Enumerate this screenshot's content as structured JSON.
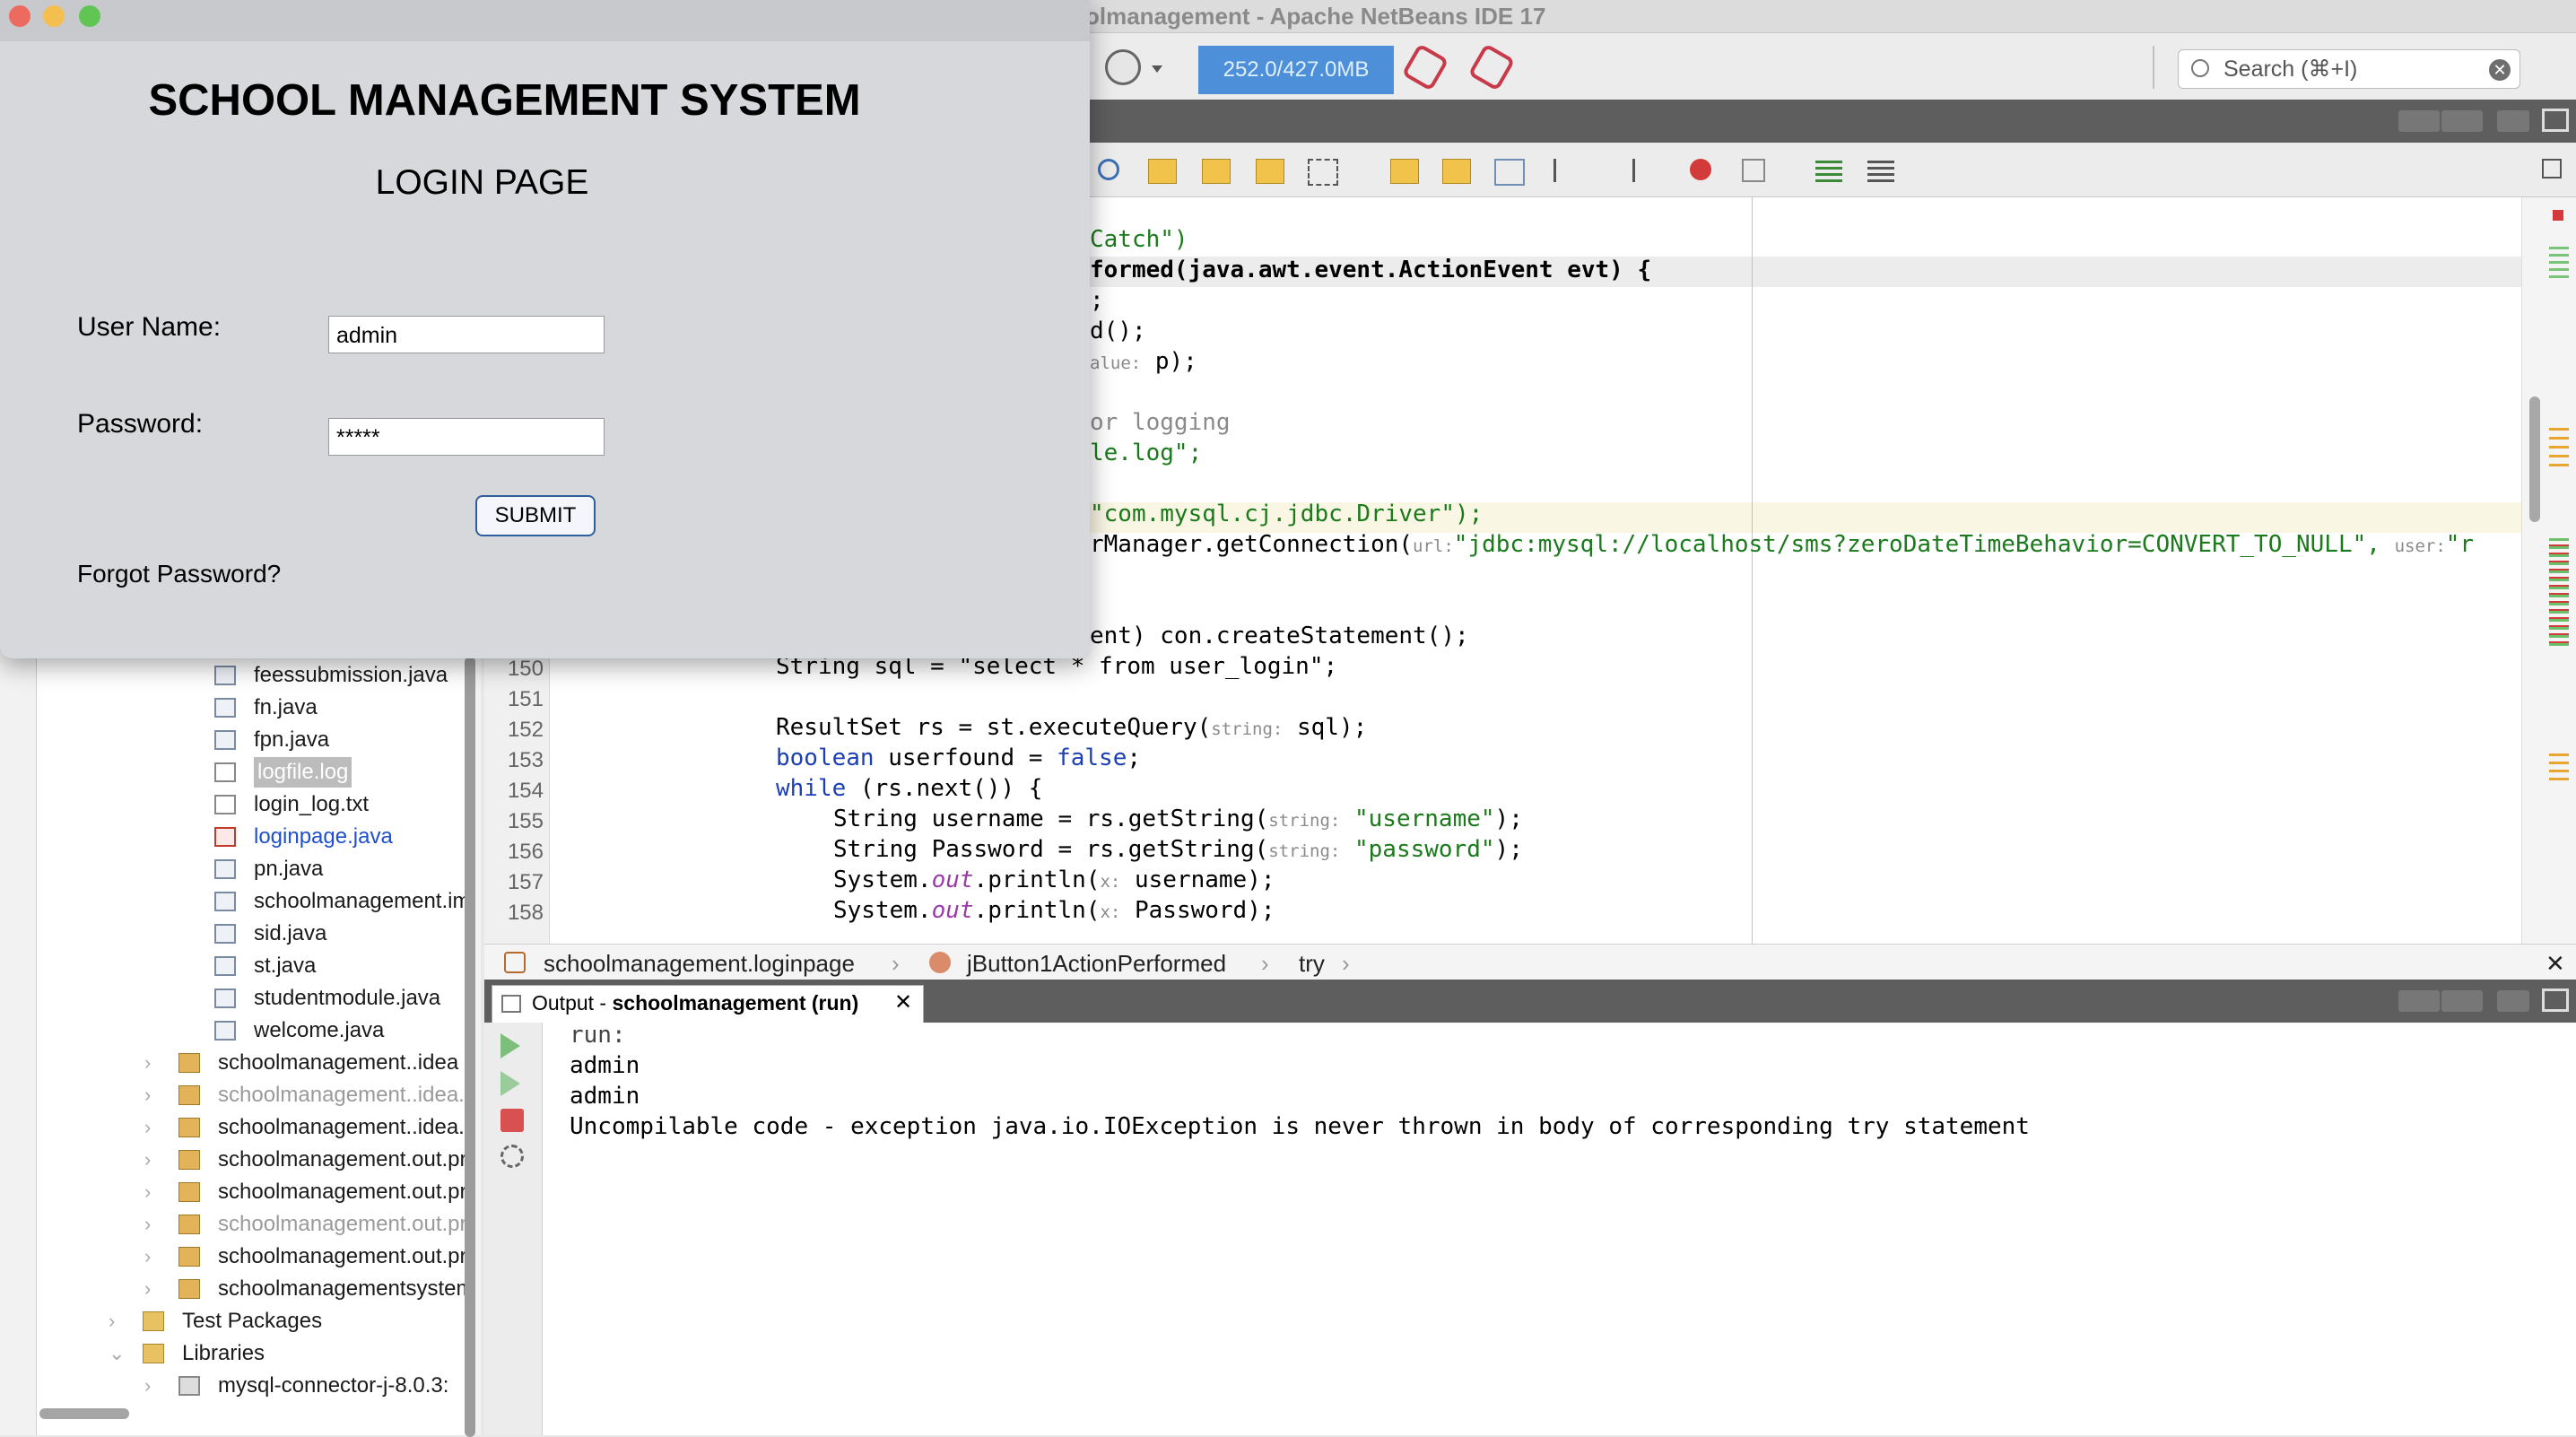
{
  "window": {
    "title": "olmanagement - Apache NetBeans IDE 17"
  },
  "toolbar": {
    "memory": "252.0/427.0MB",
    "search_placeholder": "Search (⌘+I)"
  },
  "login": {
    "heading": "SCHOOL MANAGEMENT SYSTEM",
    "subheading": "LOGIN PAGE",
    "username_label": "User Name:",
    "username_value": "admin",
    "password_label": "Password:",
    "password_value": "*****",
    "submit_label": "SUBMIT",
    "forgot_label": "Forgot Password?"
  },
  "project_tree": [
    {
      "label": "feessubmission.java",
      "type": "java"
    },
    {
      "label": "fn.java",
      "type": "java"
    },
    {
      "label": "fpn.java",
      "type": "java"
    },
    {
      "label": "logfile.log",
      "type": "file",
      "selected": true
    },
    {
      "label": "login_log.txt",
      "type": "file"
    },
    {
      "label": "loginpage.java",
      "type": "java-error",
      "link": true
    },
    {
      "label": "pn.java",
      "type": "java"
    },
    {
      "label": "schoolmanagement.im",
      "type": "java"
    },
    {
      "label": "sid.java",
      "type": "java"
    },
    {
      "label": "st.java",
      "type": "java"
    },
    {
      "label": "studentmodule.java",
      "type": "java"
    },
    {
      "label": "welcome.java",
      "type": "java"
    },
    {
      "label": "schoolmanagement..idea",
      "type": "package"
    },
    {
      "label": "schoolmanagement..idea.",
      "type": "package",
      "dim": true
    },
    {
      "label": "schoolmanagement..idea.",
      "type": "package"
    },
    {
      "label": "schoolmanagement.out.pr",
      "type": "package"
    },
    {
      "label": "schoolmanagement.out.pr",
      "type": "package"
    },
    {
      "label": "schoolmanagement.out.pr",
      "type": "package",
      "dim": true
    },
    {
      "label": "schoolmanagement.out.pr",
      "type": "package"
    },
    {
      "label": "schoolmanagementsystem",
      "type": "package-error"
    },
    {
      "label": "Test Packages",
      "type": "folder"
    },
    {
      "label": "Libraries",
      "type": "folder"
    },
    {
      "label": "mysql-connector-j-8.0.3:",
      "type": "jar"
    }
  ],
  "editor": {
    "line_numbers": [
      "150",
      "151",
      "152",
      "153",
      "154",
      "155",
      "156",
      "157",
      "158"
    ],
    "code_visible_top": [
      "Catch\")",
      "formed(java.awt.event.ActionEvent evt) {",
      ";",
      "d();",
      "p);",
      "or logging",
      "le.log\";",
      "\"com.mysql.cj.jdbc.Driver\");",
      "rManager.getConnection(",
      "ent) con.createStatement();"
    ],
    "hints": {
      "value": "alue:",
      "url": "url:",
      "user": "user:",
      "string": "string:",
      "x": "x:"
    },
    "jdbc_url": "\"jdbc:mysql://localhost/sms?zeroDateTimeBehavior=CONVERT_TO_NULL\",",
    "user_tail": "\"r",
    "lines": {
      "l150": "String sql = \"select * from user_login\";",
      "l152": "ResultSet rs = st.executeQuery(",
      "l152b": "sql);",
      "l153a": "boolean",
      "l153b": " userfound = ",
      "l153c": "false",
      "l153d": ";",
      "l154a": "while",
      "l154b": " (rs.next()) {",
      "l155a": "String username = rs.getString(",
      "l155b": "\"username\"",
      "l155c": ");",
      "l156a": "String Password = rs.getString(",
      "l156b": "\"password\"",
      "l156c": ");",
      "l157a": "System.",
      "l157b": "out",
      "l157c": ".println(",
      "l157d": "username);",
      "l158a": "System.",
      "l158b": "out",
      "l158c": ".println(",
      "l158d": "Password);"
    }
  },
  "breadcrumb": [
    "schoolmanagement.loginpage",
    "jButton1ActionPerformed",
    "try"
  ],
  "output": {
    "tab_prefix": "Output - ",
    "tab_project": "schoolmanagement (run)",
    "lines": [
      "run:",
      "admin",
      "admin",
      "Uncompilable code - exception java.io.IOException is never thrown in body of corresponding try statement"
    ]
  }
}
